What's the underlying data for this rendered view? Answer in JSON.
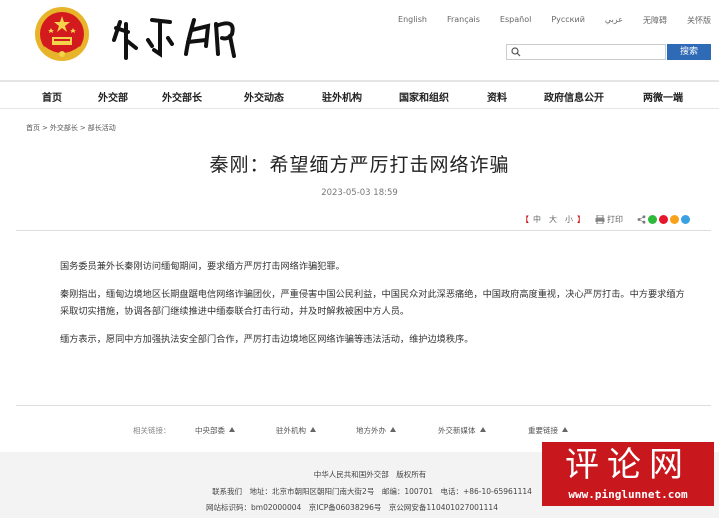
{
  "header": {
    "languages": [
      "English",
      "Français",
      "Español",
      "Русский",
      "عربي",
      "无障碍",
      "关怀版"
    ],
    "search": {
      "placeholder": "",
      "button_label": "搜索"
    }
  },
  "nav": {
    "items": [
      "首页",
      "外交部",
      "外交部长",
      "外交动态",
      "驻外机构",
      "国家和组织",
      "资料",
      "政府信息公开",
      "两微一端"
    ]
  },
  "breadcrumb": [
    "首页",
    "外交部长",
    "部长活动"
  ],
  "article": {
    "title": "秦刚：希望缅方严厉打击网络诈骗",
    "date": "2023-05-03 18:59",
    "font_size": {
      "open": "【",
      "small": "中",
      "medium": "大",
      "large": "小",
      "close": "】"
    },
    "print_label": "打印",
    "paragraphs": [
      "国务委员兼外长秦刚访问缅甸期间，要求缅方严厉打击网络诈骗犯罪。",
      "秦刚指出，缅甸边境地区长期盘踞电信网络诈骗团伙，严重侵害中国公民利益，中国民众对此深恶痛绝，中国政府高度重视，决心严厉打击。中方要求缅方采取切实措施，协调各部门继续推进中缅泰联合打击行动，并及时解救被困中方人员。",
      "缅方表示，愿同中方加强执法安全部门合作，严厉打击边境地区网络诈骗等违法活动，维护边境秩序。"
    ]
  },
  "related_links": {
    "label": "相关链接：",
    "items": [
      "中央部委",
      "驻外机构",
      "地方外办",
      "外交新媒体",
      "重要链接"
    ]
  },
  "footer": {
    "line1": "中华人民共和国外交部　版权所有",
    "line2": "联系我们　地址：北京市朝阳区朝阳门南大街2号　邮编：100701　电话：+86-10-65961114",
    "line3": "网站标识码：bm02000004　京ICP备06038296号　京公网安备110401027001114"
  },
  "watermark": {
    "title": "评论网",
    "url": "www.pinglunnet.com"
  },
  "colors": {
    "accent_blue": "#2f6ab6",
    "watermark_red": "#c8181e",
    "emblem_red": "#d21a1f",
    "emblem_gold": "#e7b42a"
  }
}
